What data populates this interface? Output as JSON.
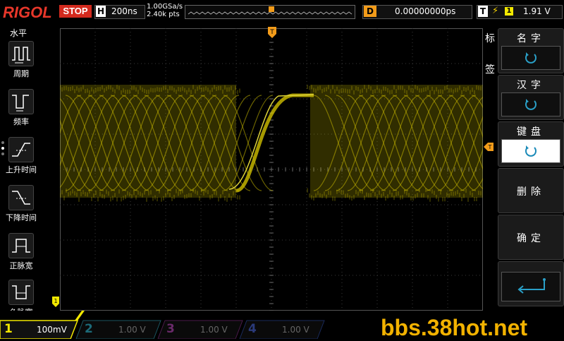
{
  "header": {
    "logo": "RIGOL",
    "run_state": "STOP",
    "horizontal": {
      "letter": "H",
      "timebase": "200ns"
    },
    "sample_rate": "1.00GSa/s",
    "memory_depth": "2.40k pts",
    "delay": {
      "letter": "D",
      "value": "0.00000000ps"
    },
    "trigger": {
      "letter": "T",
      "edge_symbol": "⚡",
      "source": "1",
      "level": "1.91 V"
    }
  },
  "left_menu": {
    "title": "水平",
    "items": [
      {
        "label": "周期",
        "icon": "period-icon"
      },
      {
        "label": "频率",
        "icon": "frequency-icon"
      },
      {
        "label": "上升时间",
        "icon": "rise-time-icon"
      },
      {
        "label": "下降时间",
        "icon": "fall-time-icon"
      },
      {
        "label": "正脉宽",
        "icon": "positive-width-icon"
      },
      {
        "label": "负脉宽",
        "icon": "negative-width-icon"
      }
    ]
  },
  "right_menu": {
    "title_chars": [
      "标",
      "签"
    ],
    "buttons": [
      {
        "label": "名字",
        "icon": "rotate-knob-icon",
        "selected": false
      },
      {
        "label": "汉字",
        "icon": "rotate-knob-icon",
        "selected": false
      },
      {
        "label": "键盘",
        "icon": "rotate-knob-icon",
        "selected": true
      },
      {
        "label": "删除",
        "icon": "",
        "selected": false
      },
      {
        "label": "确定",
        "icon": "",
        "selected": false
      },
      {
        "label": "",
        "icon": "enter-icon",
        "selected": false
      }
    ]
  },
  "channels": [
    {
      "num": "1",
      "value": "100mV",
      "color": "#f2e800",
      "active": true
    },
    {
      "num": "2",
      "value": "1.00 V",
      "color": "#20b0c8",
      "active": false
    },
    {
      "num": "3",
      "value": "1.00 V",
      "color": "#c020c0",
      "active": false
    },
    {
      "num": "4",
      "value": "1.00 V",
      "color": "#2060e0",
      "active": false
    }
  ],
  "colors": {
    "trace": "#d8c800",
    "grid": "#3a3a3a",
    "trigger_marker": "#f39c1a"
  },
  "markers": {
    "trigger_top": "T",
    "channel_ground": "1"
  },
  "watermark": "bbs.38hot.net"
}
